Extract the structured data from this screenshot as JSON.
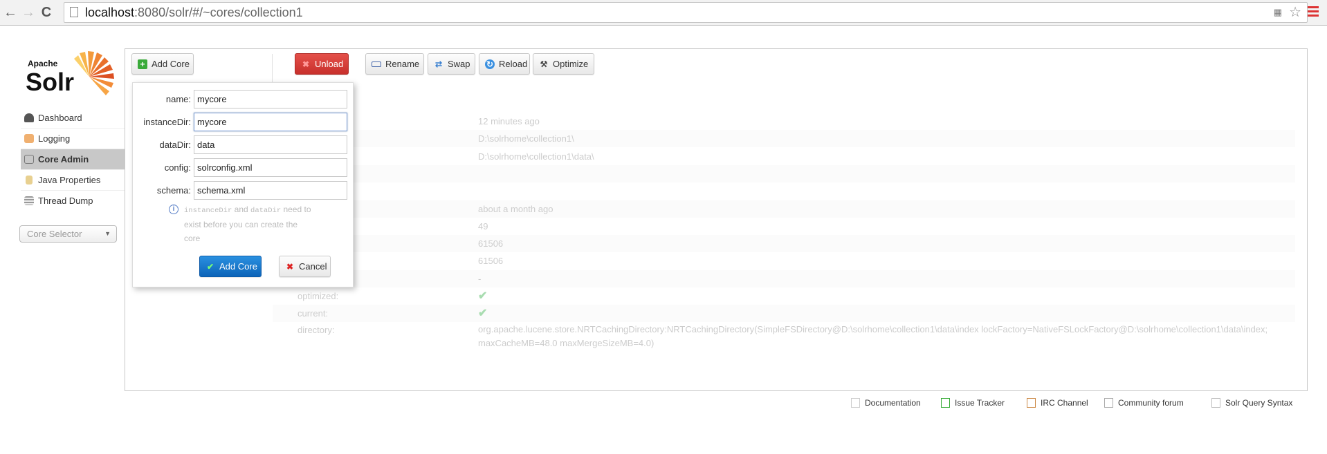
{
  "browser": {
    "url_host": "localhost",
    "url_path": ":8080/solr/#/~cores/collection1"
  },
  "logo": {
    "apache": "Apache",
    "solr": "Solr"
  },
  "sidebar": {
    "items": [
      {
        "label": "Dashboard",
        "icon": "dashboard-icon"
      },
      {
        "label": "Logging",
        "icon": "logging-icon"
      },
      {
        "label": "Core Admin",
        "icon": "core-admin-icon",
        "active": true
      },
      {
        "label": "Java Properties",
        "icon": "java-properties-icon"
      },
      {
        "label": "Thread Dump",
        "icon": "thread-dump-icon"
      }
    ],
    "core_selector": "Core Selector"
  },
  "toolbar": {
    "add_core": "Add Core",
    "unload": "Unload",
    "rename": "Rename",
    "swap": "Swap",
    "reload": "Reload",
    "optimize": "Optimize"
  },
  "dialog": {
    "fields": [
      {
        "label": "name:",
        "value": "mycore"
      },
      {
        "label": "instanceDir:",
        "value": "mycore"
      },
      {
        "label": "dataDir:",
        "value": "data"
      },
      {
        "label": "config:",
        "value": "solrconfig.xml"
      },
      {
        "label": "schema:",
        "value": "schema.xml"
      }
    ],
    "info_code1": "instanceDir",
    "info_and": " and ",
    "info_code2": "dataDir",
    "info_rest": " need to exist before you can create the core",
    "submit": "Add Core",
    "cancel": "Cancel"
  },
  "core_info": {
    "rows": [
      {
        "label": "",
        "value": "12 minutes ago"
      },
      {
        "label": "",
        "value": "D:\\solrhome\\collection1\\"
      },
      {
        "label": "",
        "value": "D:\\solrhome\\collection1\\data\\"
      },
      {
        "label": "",
        "value": ""
      },
      {
        "label": "",
        "value": ""
      },
      {
        "label": "",
        "value": "about a month ago"
      },
      {
        "label": "",
        "value": "49"
      },
      {
        "label": "",
        "value": "61506"
      },
      {
        "label": "",
        "value": "61506"
      },
      {
        "label": "",
        "value": "-"
      },
      {
        "label": "optimized:",
        "value": "✔"
      },
      {
        "label": "current:",
        "value": "✔"
      }
    ],
    "directory_label": "directory:",
    "directory_line1": "org.apache.lucene.store.NRTCachingDirectory:NRTCachingDirectory(SimpleFSDirectory@D:\\solrhome\\collection1\\data\\index lockFactory=NativeFSLockFactory@D:\\solrhome\\collection1\\data\\index;",
    "directory_line2": "maxCacheMB=48.0 maxMergeSizeMB=4.0)"
  },
  "footer": [
    "Documentation",
    "Issue Tracker",
    "IRC Channel",
    "Community forum",
    "Solr Query Syntax"
  ],
  "colors": {
    "unload": "#d23a36",
    "primary": "#1a7fd4",
    "active_nav": "#c8c8c8"
  }
}
